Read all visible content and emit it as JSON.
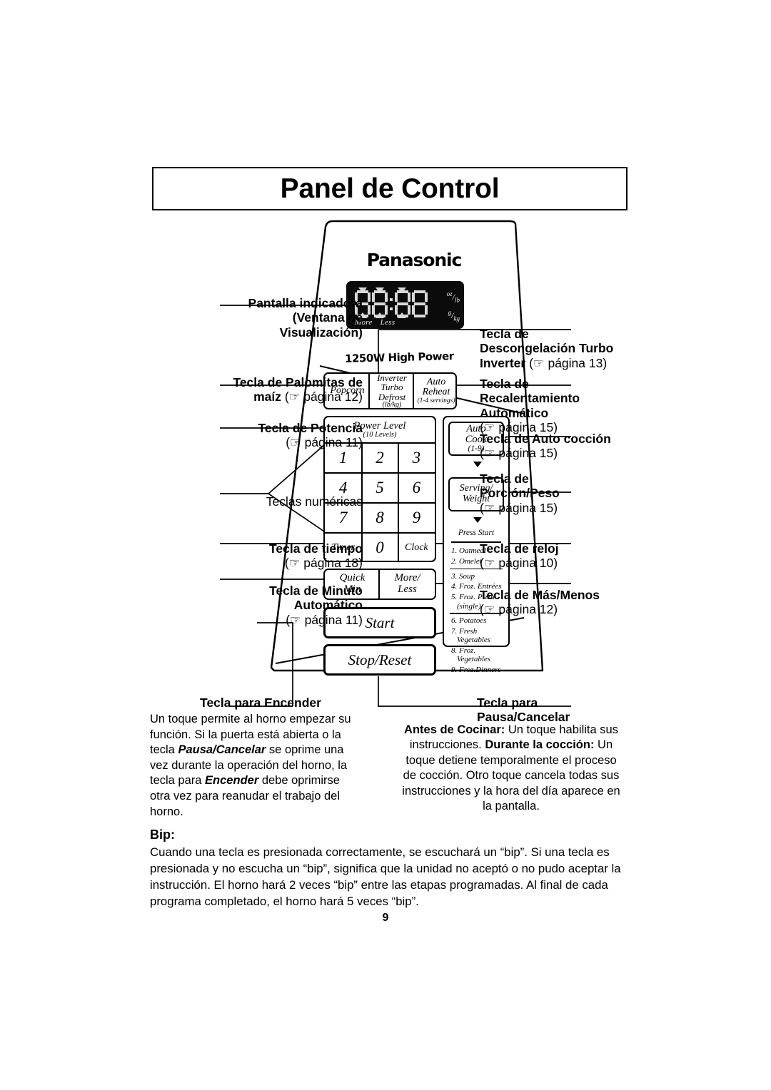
{
  "page": {
    "title": "Panel de Control",
    "number": "9"
  },
  "panel": {
    "brand": "Panasonic",
    "wattage": "1250W High Power",
    "display": {
      "value": "88:88",
      "more_label": "More",
      "less_label": "Less",
      "unit_ozlb_top": "oz",
      "unit_ozlb_bottom": "lb",
      "unit_gkg_top": "g",
      "unit_gkg_bottom": "kg"
    },
    "buttons": {
      "popcorn": "Popcorn",
      "defrost_l1": "Inverter",
      "defrost_l2": "Turbo",
      "defrost_l3": "Defrost",
      "defrost_l4": "(lb/kg)",
      "reheat_l1": "Auto",
      "reheat_l2": "Reheat",
      "reheat_l3": "(1-4 servings)",
      "power_l1": "Power Level",
      "power_l2": "(10 Levels)",
      "keys": [
        "1",
        "2",
        "3",
        "4",
        "5",
        "6",
        "7",
        "8",
        "9"
      ],
      "timer": "Timer",
      "zero": "0",
      "clock": "Clock",
      "autocook_l1": "Auto",
      "autocook_l2": "Cook",
      "autocook_l3": "(1-9)",
      "serving_l1": "Serving/",
      "serving_l2": "Weight",
      "press_start": "Press Start",
      "quick_l1": "Quick",
      "quick_l2": "Min",
      "moreless_l1": "More/",
      "moreless_l2": "Less",
      "start": "Start",
      "stop_reset": "Stop/Reset"
    },
    "auto_cook_menu": [
      {
        "num": "1.",
        "name": "Oatmeal",
        "name2": ""
      },
      {
        "num": "2.",
        "name": "Omelet",
        "name2": ""
      },
      {
        "num": "3.",
        "name": "Soup",
        "name2": ""
      },
      {
        "num": "4.",
        "name": "Froz. Entrées",
        "name2": ""
      },
      {
        "num": "5.",
        "name": "Froz. Pizza",
        "name2": "(single)"
      },
      {
        "num": "6.",
        "name": "Potatoes",
        "name2": ""
      },
      {
        "num": "7.",
        "name": "Fresh",
        "name2": "Vegetables"
      },
      {
        "num": "8.",
        "name": "Froz.",
        "name2": "Vegetables"
      },
      {
        "num": "9.",
        "name": "Froz.Dinners",
        "name2": ""
      }
    ]
  },
  "callouts": {
    "display": {
      "l1": "Pantalla indicadora",
      "l2": "(Ventana de",
      "l3": "Visualización)"
    },
    "popcorn": {
      "l1": "Tecla de Palomitas de",
      "l2": "maíz",
      "page": "(☞ página 12)"
    },
    "power": {
      "l1": "Tecla de Potencia",
      "page": "(☞ página 11)"
    },
    "numeric": {
      "l1": "Teclas numéricas"
    },
    "timer": {
      "l1": "Tecla de tiempo",
      "page": "(☞ página 18)"
    },
    "quickmin": {
      "l1": "Tecla de Minuto",
      "l2": "Automático",
      "page": "(☞ página 11)"
    },
    "defrost": {
      "l1": "Tecla de",
      "l2": "Descongelación Turbo",
      "l3": "Inverter",
      "page": "(☞ página 13)"
    },
    "reheat": {
      "l1": "Tecla de",
      "l2": "Recalentamiento",
      "l3": "Automático",
      "page": "(☞ página 15)"
    },
    "autocook": {
      "l1": "Tecla de Auto cocción",
      "page": "(☞ página 15)"
    },
    "serving": {
      "l1": "Tecla de",
      "l2": "Porción/Peso",
      "page": "(☞ página 15)"
    },
    "clock": {
      "l1": "Tecla de reloj",
      "page": "(☞ página 10)"
    },
    "moreless": {
      "l1": "Tecla de Más/Menos",
      "page": "(☞ página 12)"
    }
  },
  "sections": {
    "encender": {
      "title": "Tecla para Encender",
      "body_1": "Un toque permite al horno empezar su función. Si la puerta está abierta o la tecla ",
      "body_bold_1": "Pausa/Cancelar",
      "body_2": " se oprime una vez durante la operación del horno, la tecla para ",
      "body_bold_2": "Encender",
      "body_3": " debe oprimirse otra vez para reanudar el trabajo del horno."
    },
    "pausa": {
      "title_l1": "Tecla para",
      "title_l2": "Pausa/Cancelar",
      "lead_1": "Antes de Cocinar:",
      "body_1": " Un toque habilita sus instrucciones. ",
      "lead_2": "Durante la cocción:",
      "body_2": " Un toque detiene temporalmente el proceso de cocción. Otro toque cancela todas sus instrucciones y la hora del día aparece en la pantalla."
    },
    "bip": {
      "title": "Bip:",
      "body": "Cuando una tecla es presionada correctamente, se escuchará un “bip”. Si una tecla es presionada y no escucha un “bip”, significa que la unidad no aceptó o no pudo aceptar la instrucción. El horno hará 2 veces “bip” entre las etapas programadas. Al final de cada programa completado, el horno hará 5 veces “bip”."
    }
  },
  "colors": {
    "ink": "#000000",
    "paper": "#ffffff",
    "display_bg": "#0b0b0b",
    "display_seg": "#d9d9d9"
  }
}
